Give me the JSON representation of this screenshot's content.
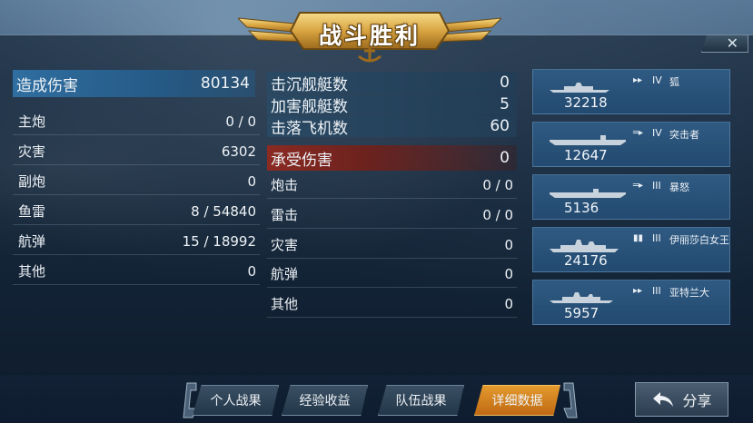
{
  "banner": {
    "title": "战斗胜利",
    "anchor_icon": "anchor-icon"
  },
  "close": {
    "glyph": "✕"
  },
  "damage_dealt": {
    "header": {
      "label": "造成伤害",
      "value": "80134"
    },
    "rows": [
      {
        "label": "主炮",
        "value": "0 / 0"
      },
      {
        "label": "灾害",
        "value": "6302"
      },
      {
        "label": "副炮",
        "value": "0"
      },
      {
        "label": "鱼雷",
        "value": "8 / 54840"
      },
      {
        "label": "航弹",
        "value": "15 / 18992"
      },
      {
        "label": "其他",
        "value": "0"
      }
    ]
  },
  "kills": [
    {
      "label": "击沉舰艇数",
      "value": "0"
    },
    {
      "label": "加害舰艇数",
      "value": "5"
    },
    {
      "label": "击落飞机数",
      "value": "60"
    }
  ],
  "damage_received": {
    "header": {
      "label": "承受伤害",
      "value": "0"
    },
    "rows": [
      {
        "label": "炮击",
        "value": "0 / 0"
      },
      {
        "label": "雷击",
        "value": "0 / 0"
      },
      {
        "label": "灾害",
        "value": "0"
      },
      {
        "label": "航弹",
        "value": "0"
      },
      {
        "label": "其他",
        "value": "0"
      }
    ]
  },
  "ships": [
    {
      "damage": "32218",
      "type_icon": "battleship-type-icon",
      "type_glyph": "▸▸",
      "tier": "IV",
      "name": "狐"
    },
    {
      "damage": "12647",
      "type_icon": "carrier-type-icon",
      "type_glyph": "═▸",
      "tier": "IV",
      "name": "突击者"
    },
    {
      "damage": "5136",
      "type_icon": "carrier-type-icon",
      "type_glyph": "═▸",
      "tier": "III",
      "name": "暴怒"
    },
    {
      "damage": "24176",
      "type_icon": "battleship-type-icon",
      "type_glyph": "▮▮",
      "tier": "III",
      "name": "伊丽莎白女王"
    },
    {
      "damage": "5957",
      "type_icon": "battleship-type-icon",
      "type_glyph": "▸▸",
      "tier": "III",
      "name": "亚特兰大"
    }
  ],
  "tabs": [
    {
      "label": "个人战果",
      "active": false
    },
    {
      "label": "经验收益",
      "active": false
    },
    {
      "label": "队伍战果",
      "active": false
    },
    {
      "label": "详细数据",
      "active": true
    }
  ],
  "share": {
    "label": "分享",
    "icon": "share-arrow-icon"
  },
  "colors": {
    "active_tab": "#d98324",
    "header_blue": "#2f6ea0",
    "header_red": "#8a2a22",
    "ship_card": "#2a5279"
  }
}
